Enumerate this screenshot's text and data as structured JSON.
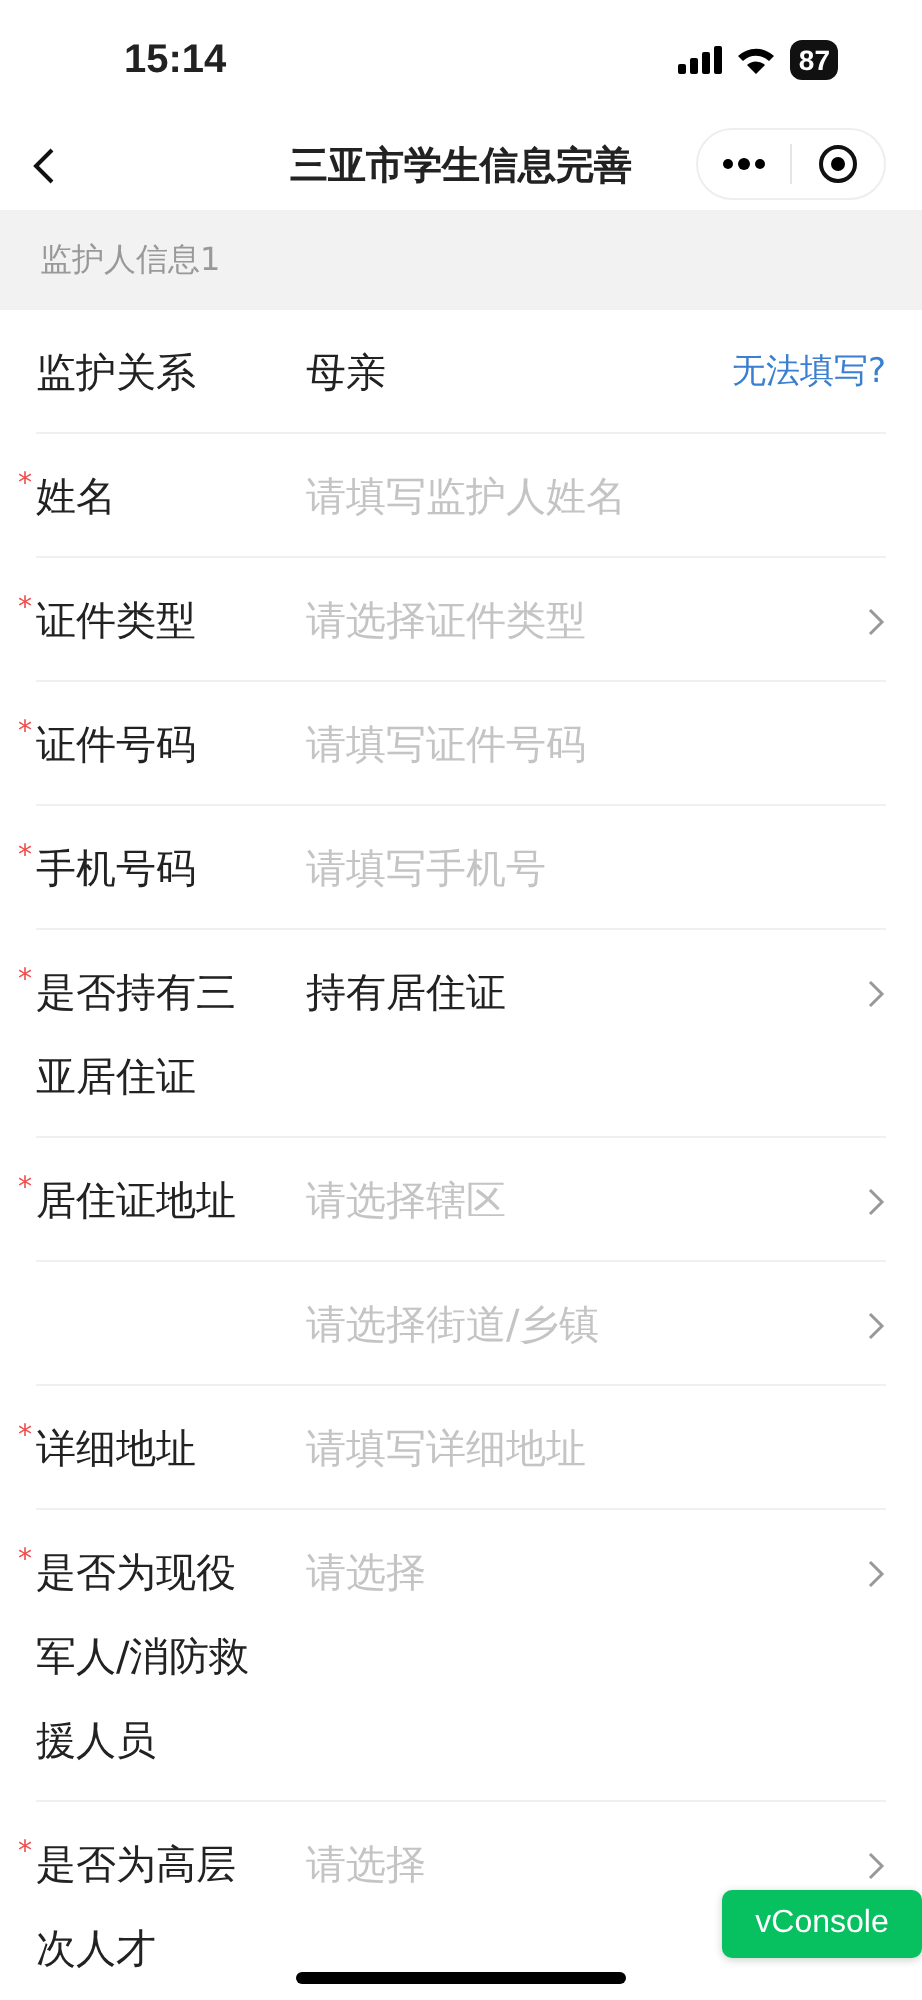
{
  "status_bar": {
    "time": "15:14",
    "battery": "87"
  },
  "nav": {
    "title": "三亚市学生信息完善"
  },
  "section": {
    "title": "监护人信息1"
  },
  "rows": [
    {
      "kind": "text",
      "label": "监护关系",
      "value": "母亲",
      "link": "无法填写?"
    },
    {
      "kind": "input",
      "required_mark": "*",
      "label": "姓名",
      "placeholder": "请填写监护人姓名"
    },
    {
      "kind": "select",
      "required_mark": "*",
      "label": "证件类型",
      "placeholder": "请选择证件类型"
    },
    {
      "kind": "input",
      "required_mark": "*",
      "label": "证件号码",
      "placeholder": "请填写证件号码"
    },
    {
      "kind": "input",
      "required_mark": "*",
      "label": "手机号码",
      "placeholder": "请填写手机号"
    },
    {
      "kind": "select",
      "required_mark": "*",
      "label": "是否持有三亚居住证",
      "value": "持有居住证"
    },
    {
      "kind": "select",
      "required_mark": "*",
      "label": "居住证地址",
      "placeholder": "请选择辖区"
    },
    {
      "kind": "select",
      "placeholder": "请选择街道/乡镇"
    },
    {
      "kind": "input",
      "required_mark": "*",
      "label": "详细地址",
      "placeholder": "请填写详细地址"
    },
    {
      "kind": "select",
      "required_mark": "*",
      "label": "是否为现役军人/消防救援人员",
      "placeholder": "请选择"
    },
    {
      "kind": "select",
      "required_mark": "*",
      "label": "是否为高层次人才",
      "placeholder": "请选择"
    }
  ],
  "floating_button": {
    "label": "vConsole"
  }
}
